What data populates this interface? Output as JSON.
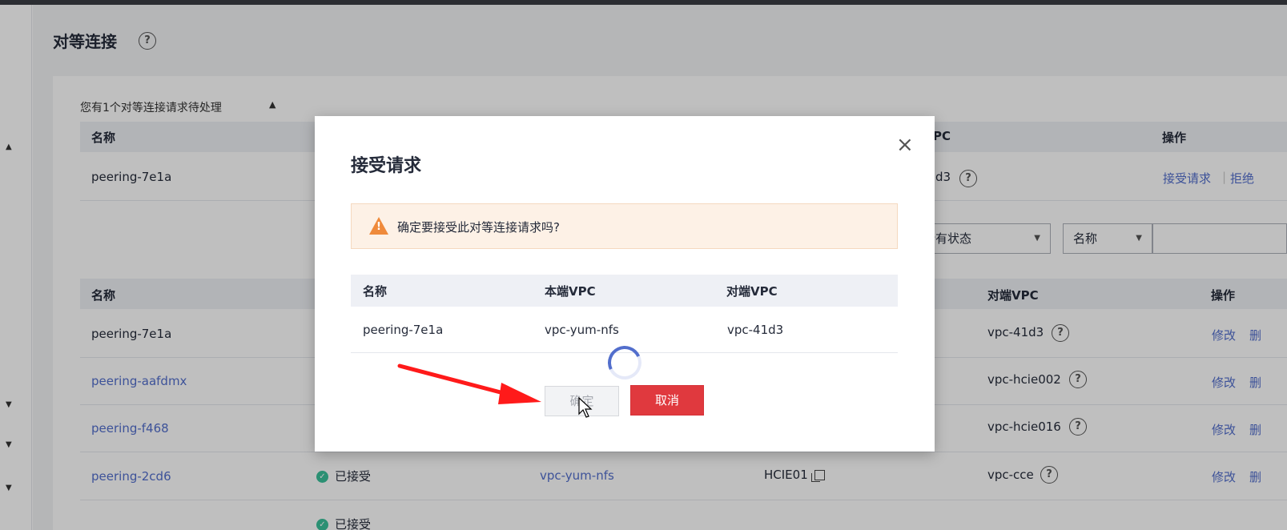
{
  "page": {
    "title": "对等连接",
    "help_icon": "question-circle-icon"
  },
  "pending": {
    "title": "您有1个对等连接请求待处理",
    "columns": [
      "名称",
      "PC",
      "操作"
    ],
    "row": {
      "name": "peering-7e1a",
      "peer_vpc_partial": "d3",
      "action_accept": "接受请求",
      "action_reject_partial": "拒绝"
    }
  },
  "filters": {
    "status": "所有状态",
    "field": "名称"
  },
  "main_table": {
    "columns": {
      "name": "名称",
      "peer_vpc": "对端VPC",
      "ops": "操作"
    },
    "rows": [
      {
        "name": "peering-7e1a",
        "peer_vpc": "vpc-41d3",
        "op": "修改",
        "op_cut": "删"
      },
      {
        "name": "peering-aafdmx",
        "peer_vpc": "vpc-hcie002",
        "op": "修改",
        "op_cut": "删"
      },
      {
        "name": "peering-f468",
        "peer_vpc": "vpc-hcie016",
        "op": "修改",
        "op_cut": "删"
      },
      {
        "name": "peering-2cd6",
        "status": "已接受",
        "local_vpc": "vpc-yum-nfs",
        "project": "HCIE01",
        "peer_vpc": "vpc-cce",
        "op": "修改",
        "op_cut": "删"
      }
    ],
    "next_row_partial": {
      "status": "已接受"
    }
  },
  "modal": {
    "title": "接受请求",
    "warning": "确定要接受此对等连接请求吗?",
    "columns": {
      "name": "名称",
      "local_vpc": "本端VPC",
      "peer_vpc": "对端VPC"
    },
    "row": {
      "name": "peering-7e1a",
      "local_vpc": "vpc-yum-nfs",
      "peer_vpc": "vpc-41d3"
    },
    "ok_label": "确定",
    "cancel_label": "取消"
  },
  "colors": {
    "accent": "#526ecc",
    "danger": "#e0393e",
    "warning": "#ef8a3b",
    "success": "#3ac09a",
    "annotation_arrow": "#ff1a1a"
  }
}
